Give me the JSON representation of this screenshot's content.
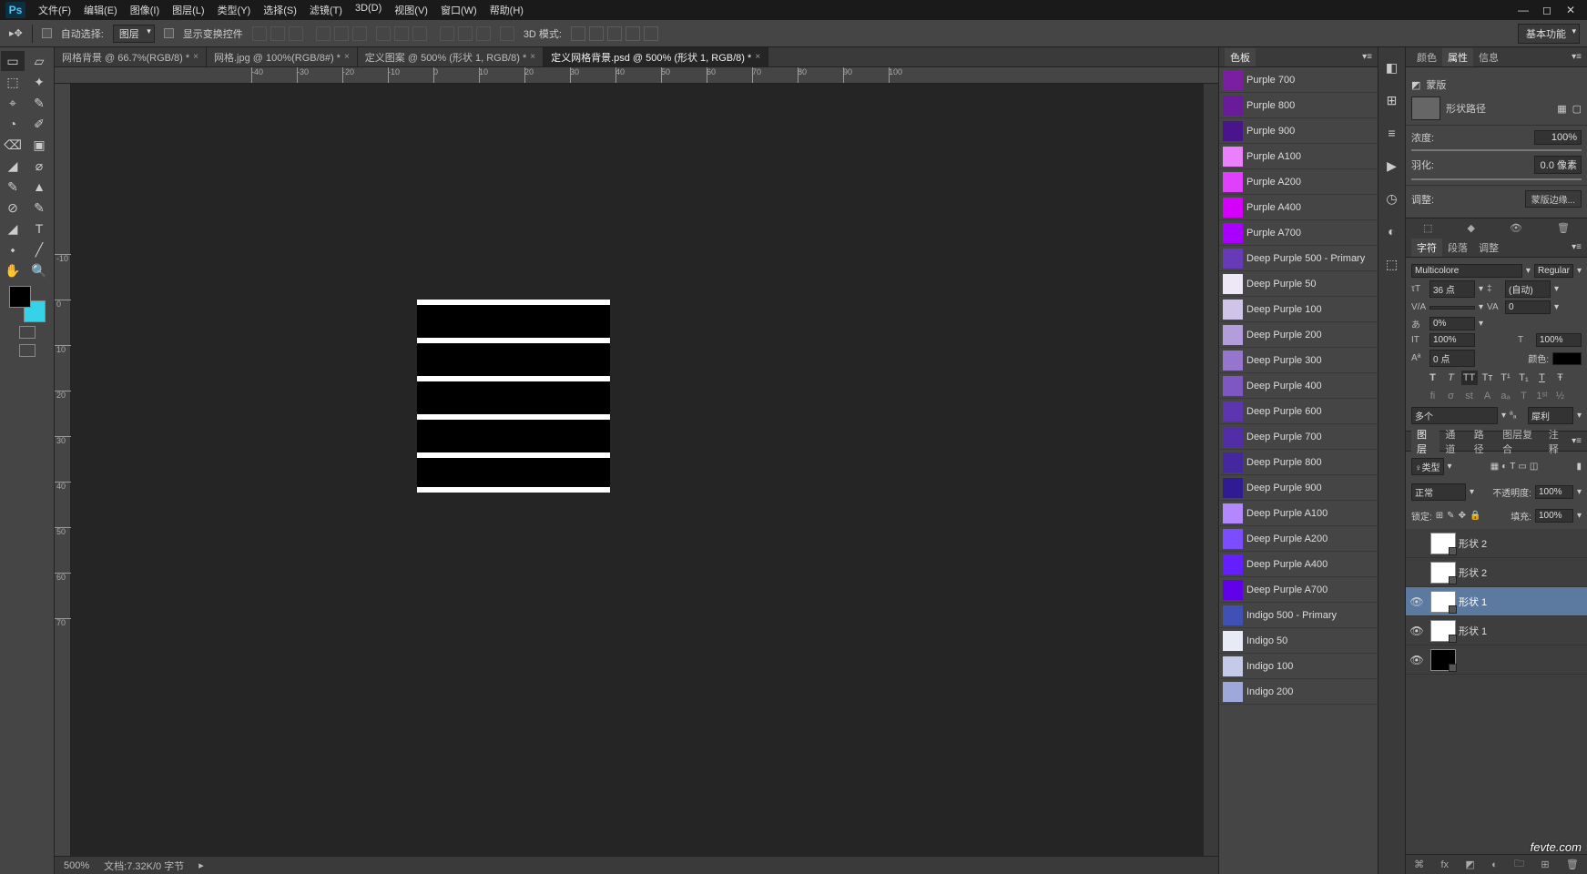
{
  "app": {
    "logo": "Ps"
  },
  "menu": [
    "文件(F)",
    "编辑(E)",
    "图像(I)",
    "图层(L)",
    "类型(Y)",
    "选择(S)",
    "滤镜(T)",
    "3D(D)",
    "视图(V)",
    "窗口(W)",
    "帮助(H)"
  ],
  "options": {
    "auto_select": "自动选择:",
    "target": "图层",
    "show_controls": "显示变换控件",
    "mode3d": "3D 模式:"
  },
  "workspace": "基本功能",
  "tabs": [
    {
      "label": "网格背景 @ 66.7%(RGB/8) *",
      "active": false
    },
    {
      "label": "网格.jpg @ 100%(RGB/8#) *",
      "active": false
    },
    {
      "label": "定义图案 @ 500% (形状 1, RGB/8) *",
      "active": false
    },
    {
      "label": "定义网格背景.psd @ 500% (形状 1, RGB/8) *",
      "active": true
    }
  ],
  "ruler_ticks": [
    -40,
    -30,
    -20,
    -10,
    0,
    10,
    20,
    30,
    40,
    50,
    60,
    70,
    80,
    90,
    100
  ],
  "ruler_v": [
    -10,
    0,
    10,
    20,
    30,
    40,
    50,
    60,
    70
  ],
  "status": {
    "zoom": "500%",
    "doc": "文档:7.32K/0 字节"
  },
  "swatches_tab": "色板",
  "swatches": [
    {
      "name": "Purple 700",
      "c": "#7b1fa2"
    },
    {
      "name": "Purple 800",
      "c": "#6a1b9a"
    },
    {
      "name": "Purple 900",
      "c": "#4a148c"
    },
    {
      "name": "Purple A100",
      "c": "#ea80fc"
    },
    {
      "name": "Purple A200",
      "c": "#e040fb"
    },
    {
      "name": "Purple A400",
      "c": "#d500f9"
    },
    {
      "name": "Purple A700",
      "c": "#aa00ff"
    },
    {
      "name": "Deep Purple 500 - Primary",
      "c": "#673ab7"
    },
    {
      "name": "Deep Purple 50",
      "c": "#ede7f6"
    },
    {
      "name": "Deep Purple 100",
      "c": "#d1c4e9"
    },
    {
      "name": "Deep Purple 200",
      "c": "#b39ddb"
    },
    {
      "name": "Deep Purple 300",
      "c": "#9575cd"
    },
    {
      "name": "Deep Purple 400",
      "c": "#7e57c2"
    },
    {
      "name": "Deep Purple 600",
      "c": "#5e35b1"
    },
    {
      "name": "Deep Purple 700",
      "c": "#512da8"
    },
    {
      "name": "Deep Purple 800",
      "c": "#4527a0"
    },
    {
      "name": "Deep Purple 900",
      "c": "#311b92"
    },
    {
      "name": "Deep Purple A100",
      "c": "#b388ff"
    },
    {
      "name": "Deep Purple A200",
      "c": "#7c4dff"
    },
    {
      "name": "Deep Purple A400",
      "c": "#651fff"
    },
    {
      "name": "Deep Purple A700",
      "c": "#6200ea"
    },
    {
      "name": "Indigo 500 - Primary",
      "c": "#3f51b5"
    },
    {
      "name": "Indigo 50",
      "c": "#e8eaf6"
    },
    {
      "name": "Indigo 100",
      "c": "#c5cae9"
    },
    {
      "name": "Indigo 200",
      "c": "#9fa8da"
    }
  ],
  "props": {
    "tabs": [
      "颜色",
      "属性",
      "信息"
    ],
    "title": "蒙版",
    "path": "形状路径",
    "density_lbl": "浓度:",
    "density": "100%",
    "feather_lbl": "羽化:",
    "feather": "0.0 像素",
    "adjust_lbl": "调整:",
    "mask_edge_btn": "蒙版边缘..."
  },
  "char": {
    "tabs": [
      "字符",
      "段落",
      "调整"
    ],
    "font": "Multicolore",
    "style": "Regular",
    "size": "36 点",
    "leading": "(自动)",
    "tracking": "0",
    "vscale": "100%",
    "hscale": "100%",
    "baseline": "0 点",
    "ratio": "0%",
    "color_lbl": "颜色:",
    "lang": "多个",
    "aa": "犀利"
  },
  "layers": {
    "tabs": [
      "图层",
      "通道",
      "路径",
      "图层复合",
      "注释"
    ],
    "kind": "♀类型",
    "blend": "正常",
    "opacity_lbl": "不透明度:",
    "opacity": "100%",
    "lock_lbl": "锁定:",
    "fill_lbl": "填充:",
    "fill": "100%",
    "items": [
      {
        "name": "形状 2",
        "vis": false,
        "sel": false
      },
      {
        "name": "形状 2",
        "vis": false,
        "sel": false
      },
      {
        "name": "形状 1",
        "vis": true,
        "sel": true
      },
      {
        "name": "形状 1",
        "vis": true,
        "sel": false
      },
      {
        "name": "",
        "vis": true,
        "sel": false,
        "black": true
      }
    ]
  },
  "watermark": "fevte.com"
}
